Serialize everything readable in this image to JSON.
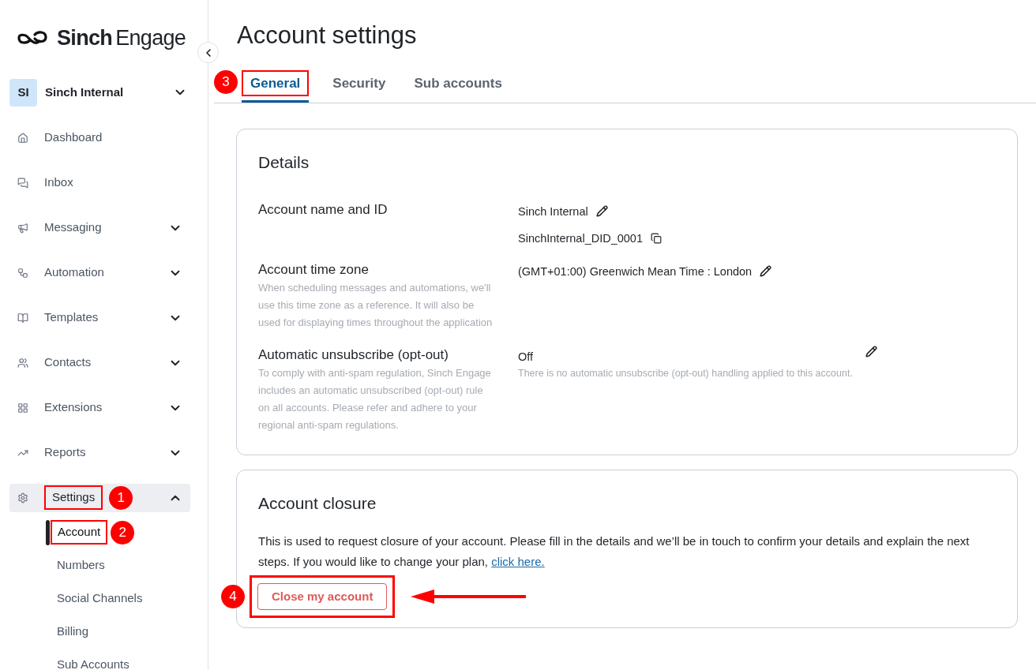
{
  "logo": {
    "brand": "Sinch",
    "product": "Engage"
  },
  "account_switcher": {
    "initials": "SI",
    "name": "Sinch Internal"
  },
  "sidebar": {
    "items": [
      {
        "label": "Dashboard",
        "kind": "link"
      },
      {
        "label": "Inbox",
        "kind": "link"
      },
      {
        "label": "Messaging",
        "kind": "group",
        "expanded": false
      },
      {
        "label": "Automation",
        "kind": "group",
        "expanded": false
      },
      {
        "label": "Templates",
        "kind": "group",
        "expanded": false
      },
      {
        "label": "Contacts",
        "kind": "group",
        "expanded": false
      },
      {
        "label": "Extensions",
        "kind": "group",
        "expanded": false
      },
      {
        "label": "Reports",
        "kind": "group",
        "expanded": false
      },
      {
        "label": "Settings",
        "kind": "group",
        "expanded": true,
        "callout": "1",
        "children": [
          {
            "label": "Account",
            "selected": true,
            "callout": "2"
          },
          {
            "label": "Numbers",
            "selected": false
          },
          {
            "label": "Social Channels",
            "selected": false
          },
          {
            "label": "Billing",
            "selected": false
          },
          {
            "label": "Sub Accounts",
            "selected": false
          }
        ]
      }
    ]
  },
  "page_title": "Account settings",
  "tabs": [
    {
      "label": "General",
      "selected": true,
      "callout": "3"
    },
    {
      "label": "Security",
      "selected": false
    },
    {
      "label": "Sub accounts",
      "selected": false
    }
  ],
  "details": {
    "title": "Details",
    "rows": [
      {
        "label": "Account name and ID",
        "kind": "inline",
        "values": [
          {
            "text": "Sinch Internal",
            "kind": "edit"
          },
          {
            "text": "SinchInternal_DID_0001",
            "kind": "copy"
          }
        ]
      },
      {
        "label": "Account time zone",
        "description": "When scheduling messages and automations, we'll use this time zone as a reference. It will also be used for displaying times throughout the application",
        "kind": "inline",
        "values": [
          {
            "text": "(GMT+01:00) Greenwich Mean Time : London",
            "kind": "edit"
          }
        ]
      },
      {
        "label": "Automatic unsubscribe (opt-out)",
        "description": "To comply with anti-spam regulation, Sinch Engage includes an automatic unsubscribed (opt-out) rule on all accounts. Please refer and adhere to your regional anti-spam regulations.",
        "kind": "side",
        "values": [
          {
            "text": "Off",
            "note": "There is no automatic unsubscribe (opt-out) handling applied to this account.",
            "kind": "edit"
          }
        ]
      }
    ]
  },
  "closure": {
    "title": "Account closure",
    "text": "This is used to request closure of your account. Please fill in the details and we’ll be in touch to confirm your details and explain the next steps. If you would like to change your plan,",
    "link": "click here.",
    "button": {
      "label": "Close my account",
      "callout": "4"
    }
  }
}
